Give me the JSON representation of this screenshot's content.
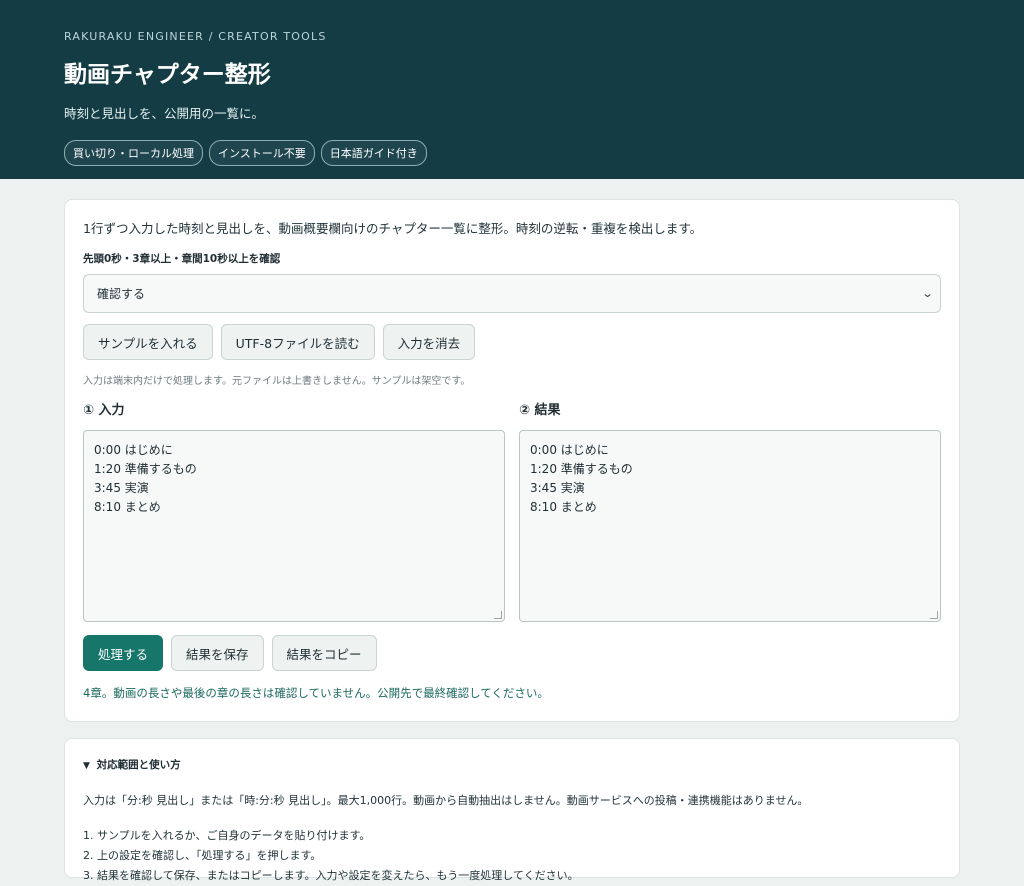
{
  "header": {
    "eyebrow": "RAKURAKU ENGINEER / CREATOR TOOLS",
    "title": "動画チャプター整形",
    "subtitle": "時刻と見出しを、公開用の一覧に。",
    "badges": [
      "買い切り・ローカル処理",
      "インストール不要",
      "日本語ガイド付き"
    ]
  },
  "main": {
    "description": "1行ずつ入力した時刻と見出しを、動画概要欄向けのチャプター一覧に整形。時刻の逆転・重複を検出します。",
    "check_label": "先頭0秒・3章以上・章間10秒以上を確認",
    "check_select": {
      "value": "確認する"
    },
    "buttons": {
      "sample": "サンプルを入れる",
      "read_file": "UTF-8ファイルを読む",
      "clear": "入力を消去"
    },
    "note": "入力は端末内だけで処理します。元ファイルは上書きしません。サンプルは架空です。",
    "input_panel": {
      "title": "① 入力",
      "lines": [
        "0:00 はじめに",
        "1:20 準備するもの",
        "3:45 実演",
        "8:10 まとめ"
      ]
    },
    "result_panel": {
      "title": "② 結果",
      "lines": [
        "0:00 はじめに",
        "1:20 準備するもの",
        "3:45 実演",
        "8:10 まとめ"
      ]
    },
    "actions": {
      "process": "処理する",
      "save": "結果を保存",
      "copy": "結果をコピー"
    },
    "status": "4章。動画の長さや最後の章の長さは確認していません。公開先で最終確認してください。"
  },
  "help": {
    "summary": "対応範囲と使い方",
    "text": "入力は「分:秒 見出し」または「時:分:秒 見出し」。最大1,000行。動画から自動抽出はしません。動画サービスへの投稿・連携機能はありません。",
    "steps": [
      "1. サンプルを入れるか、ご自身のデータを貼り付けます。",
      "2. 上の設定を確認し、「処理する」を押します。",
      "3. 結果を確認して保存、またはコピーします。入力や設定を変えたら、もう一度処理してください。"
    ]
  },
  "colors": {
    "header_bg": "#143c45",
    "accent": "#16766a",
    "page_bg": "#edf2f1"
  }
}
